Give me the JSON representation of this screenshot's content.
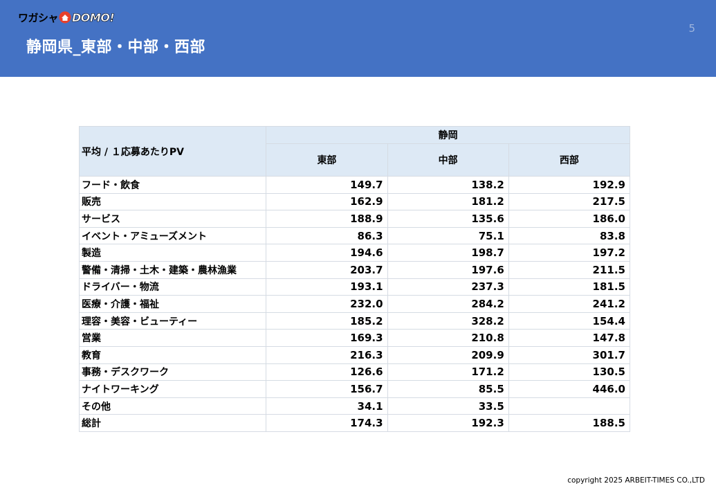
{
  "header": {
    "logo_kana": "ワガシャ",
    "logo_latin": "DOMO!",
    "title": "静岡県_東部・中部・西部",
    "page_number": "5"
  },
  "table": {
    "corner_label": "平均 / １応募あたりPV",
    "group_label": "静岡",
    "columns": [
      "東部",
      "中部",
      "西部"
    ],
    "rows": [
      {
        "label": "フード・飲食",
        "values": [
          "149.7",
          "138.2",
          "192.9"
        ]
      },
      {
        "label": "販売",
        "values": [
          "162.9",
          "181.2",
          "217.5"
        ]
      },
      {
        "label": "サービス",
        "values": [
          "188.9",
          "135.6",
          "186.0"
        ]
      },
      {
        "label": "イベント・アミューズメント",
        "values": [
          "86.3",
          "75.1",
          "83.8"
        ]
      },
      {
        "label": "製造",
        "values": [
          "194.6",
          "198.7",
          "197.2"
        ]
      },
      {
        "label": "警備・清掃・土木・建築・農林漁業",
        "values": [
          "203.7",
          "197.6",
          "211.5"
        ]
      },
      {
        "label": "ドライバー・物流",
        "values": [
          "193.1",
          "237.3",
          "181.5"
        ]
      },
      {
        "label": "医療・介護・福祉",
        "values": [
          "232.0",
          "284.2",
          "241.2"
        ]
      },
      {
        "label": "理容・美容・ビューティー",
        "values": [
          "185.2",
          "328.2",
          "154.4"
        ]
      },
      {
        "label": "営業",
        "values": [
          "169.3",
          "210.8",
          "147.8"
        ]
      },
      {
        "label": "教育",
        "values": [
          "216.3",
          "209.9",
          "301.7"
        ]
      },
      {
        "label": "事務・デスクワーク",
        "values": [
          "126.6",
          "171.2",
          "130.5"
        ]
      },
      {
        "label": "ナイトワーキング",
        "values": [
          "156.7",
          "85.5",
          "446.0"
        ]
      },
      {
        "label": "その他",
        "values": [
          "34.1",
          "33.5",
          ""
        ]
      },
      {
        "label": "総計",
        "values": [
          "174.3",
          "192.3",
          "188.5"
        ]
      }
    ]
  },
  "footer": {
    "copyright": "copyright 2025 ARBEIT-TIMES CO.,LTD"
  },
  "colors": {
    "header_bg": "#4472c4",
    "table_header_bg": "#dde9f5"
  }
}
